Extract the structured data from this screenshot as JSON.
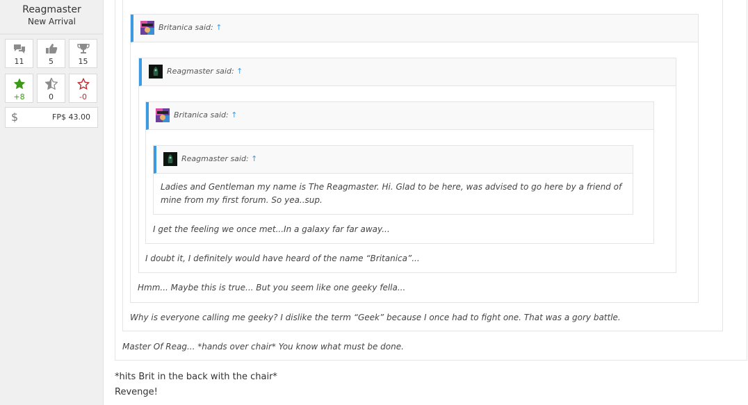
{
  "user": {
    "name": "Reagmaster",
    "title": "New Arrival",
    "stats": [
      {
        "icon": "comments-icon",
        "value": "11"
      },
      {
        "icon": "thumbs-up-icon",
        "value": "5"
      },
      {
        "icon": "trophy-icon",
        "value": "15"
      },
      {
        "icon": "star-icon",
        "value": "+8",
        "color": "#3d9a16"
      },
      {
        "icon": "half-star-icon",
        "value": "0"
      },
      {
        "icon": "empty-star-icon",
        "value": "-0",
        "color": "#c0282e"
      }
    ],
    "fp_symbol": "$",
    "fp_balance": "FP$ 43.00"
  },
  "quotes": [
    {
      "author": "Britanica",
      "said": "said:",
      "arrow": "↑",
      "text": "Master Of Reag... *hands over chair* You know what must be done."
    },
    {
      "author": "Reagmaster",
      "said": "said:",
      "arrow": "↑",
      "text": "Why is everyone calling me geeky? I dislike the term “Geek” because I once had to fight one. That was a gory battle."
    },
    {
      "author": "Britanica",
      "said": "said:",
      "arrow": "↑",
      "text": "Hmm... Maybe this is true... But you seem like one geeky fella..."
    },
    {
      "author": "Reagmaster",
      "said": "said:",
      "arrow": "↑",
      "text": "I doubt it, I definitely would have heard of the name “Britanica”..."
    },
    {
      "author": "Britanica",
      "said": "said:",
      "arrow": "↑",
      "text": "I get the feeling we once met...In a galaxy far far away..."
    },
    {
      "author": "Reagmaster",
      "said": "said:",
      "arrow": "↑",
      "text": "Ladies and Gentleman my name is The Reagmaster. Hi. Glad to be here, was advised to go here by a friend of mine from my first forum. So yea..sup."
    }
  ],
  "reply": {
    "line1": "*hits Brit in the back with the chair*",
    "line2": "Revenge!"
  },
  "colors": {
    "quote_accent": "#3b9ae1",
    "positive": "#3d9a16",
    "negative": "#c0282e"
  }
}
